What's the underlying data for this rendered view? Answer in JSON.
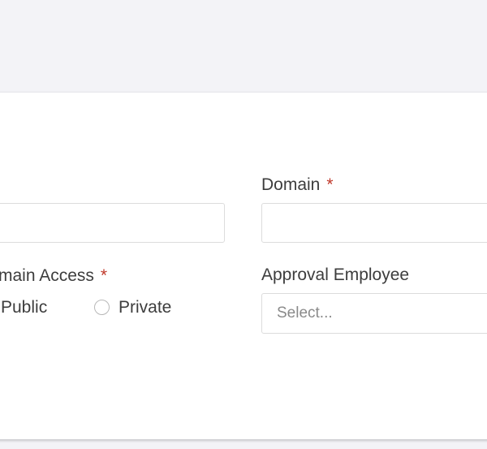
{
  "form": {
    "domain_label": "Domain",
    "domain_access_label": "main Access",
    "approval_employee_label": "Approval Employee",
    "required_marker": "*",
    "domain_access_options": [
      {
        "label": "Public",
        "selected": false
      },
      {
        "label": "Private",
        "selected": false
      }
    ],
    "approval_employee_placeholder": "Select...",
    "domain_value": "",
    "left_field_value": ""
  }
}
